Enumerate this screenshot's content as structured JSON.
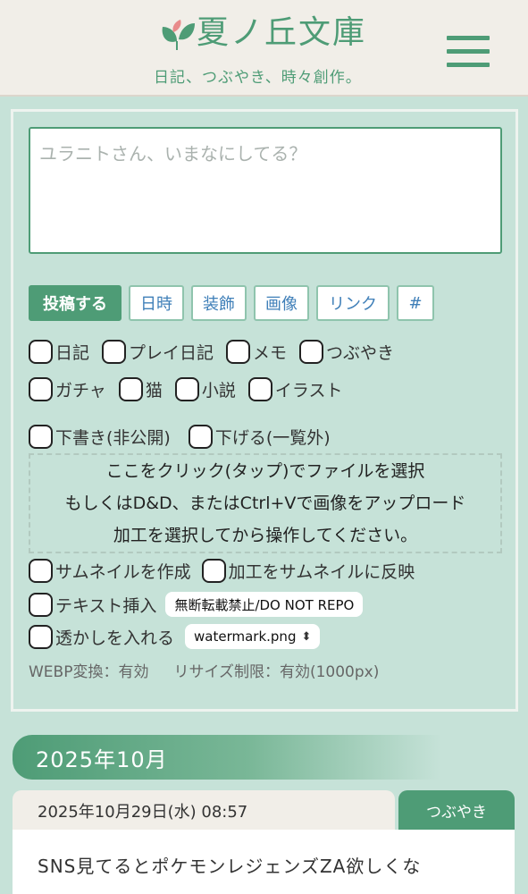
{
  "header": {
    "title": "夏ノ丘文庫",
    "tagline": "日記、つぶやき、時々創作。"
  },
  "compose": {
    "placeholder": "ユラニトさん、いまなにしてる？"
  },
  "toolbar": {
    "post": "投稿する",
    "date": "日時",
    "decoration": "装飾",
    "image": "画像",
    "link": "リンク",
    "hashtag": "#"
  },
  "categories": {
    "diary": "日記",
    "play_diary": "プレイ日記",
    "memo": "メモ",
    "tweet": "つぶやき",
    "gacha": "ガチャ",
    "cat": "猫",
    "novel": "小説",
    "illust": "イラスト"
  },
  "options": {
    "draft": "下書き(非公開)",
    "lower": "下げる(一覧外)"
  },
  "dropzone": {
    "line1": "ここをクリック(タップ)でファイルを選択",
    "line2": "もしくはD&D、またはCtrl+Vで画像をアップロード",
    "line3": "加工を選択してから操作してください。"
  },
  "image_options": {
    "make_thumbnail": "サムネイルを作成",
    "apply_to_thumbnail": "加工をサムネイルに反映",
    "insert_text": "テキスト挿入",
    "insert_text_value": "無断転載禁止/DO NOT REPO",
    "watermark": "透かしを入れる",
    "watermark_file": "watermark.png"
  },
  "info": {
    "webp": "WEBP変換：有効",
    "resize": "リサイズ制限：有効(1000px)"
  },
  "month": "2025年10月",
  "post": {
    "date": "2025年10月29日(水) 08:57",
    "category": "つぶやき",
    "text": "SNS見てるとポケモンレジェンズZA欲しくな"
  },
  "colors": {
    "accent": "#4e9c76",
    "background": "#c6e2d8",
    "header_bg": "#f1eee8",
    "tool_text": "#3f7fb8"
  }
}
